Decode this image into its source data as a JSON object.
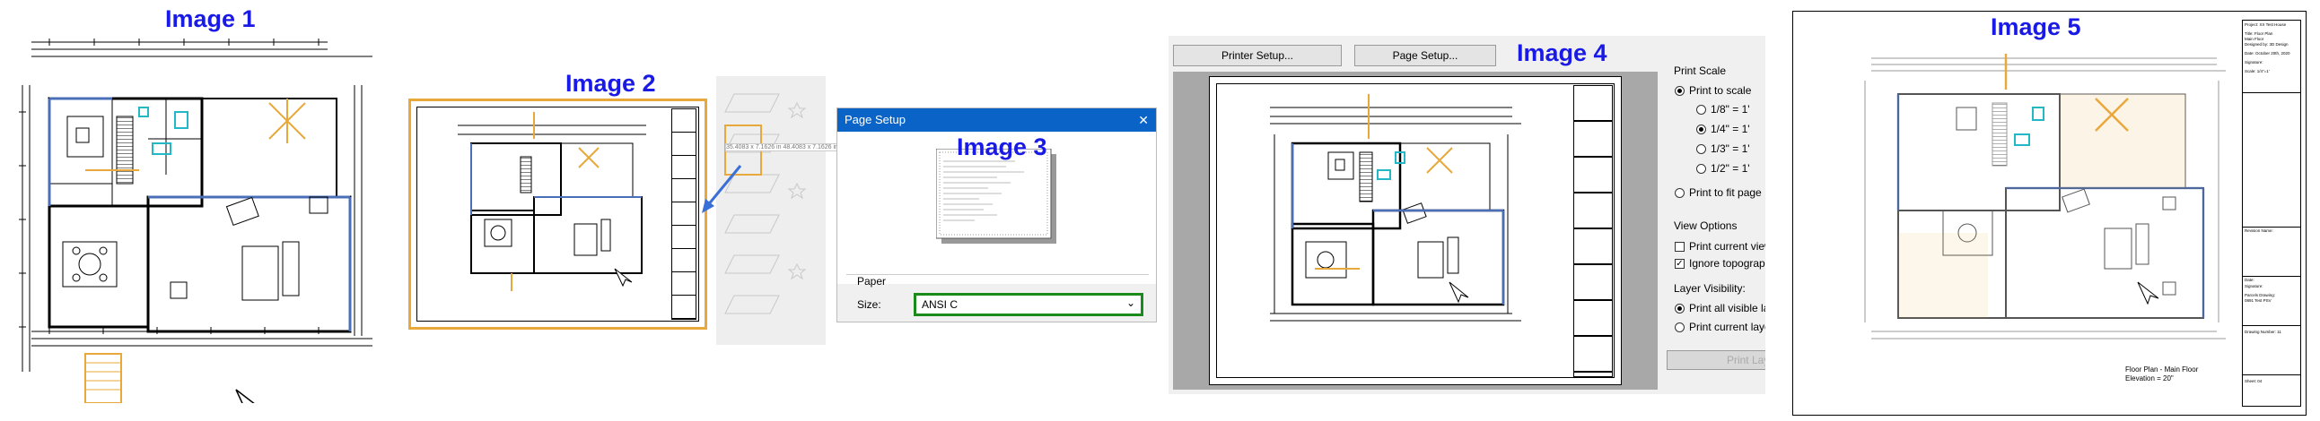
{
  "captions": {
    "image1": "Image 1",
    "image2": "Image 2",
    "image3": "Image 3",
    "image4": "Image 4",
    "image5": "Image 5"
  },
  "image2": {
    "coord_readout": "35.4083 x 7.1626 in 48.4083 x 7.1626 in"
  },
  "page_setup": {
    "title": "Page Setup",
    "close_glyph": "✕",
    "paper_group": "Paper",
    "size_label": "Size:",
    "size_value": "ANSI C"
  },
  "print_dialog": {
    "printer_setup_button": "Printer Setup...",
    "page_setup_button": "Page Setup...",
    "print_scale_label": "Print Scale",
    "print_to_scale": "Print to scale",
    "scales": [
      "1/8\" = 1'",
      "1/4\" = 1'",
      "1/3\" = 1'",
      "1/2\" = 1'"
    ],
    "selected_scale_index": 1,
    "print_to_fit": "Print to fit page",
    "view_options_label": "View Options",
    "print_current_view": "Print current view",
    "ignore_topography": "Ignore topography",
    "layer_visibility_label": "Layer Visibility:",
    "print_all_visible": "Print all visible layers",
    "print_current_layer": "Print current layer",
    "print_button": "Print Layout"
  },
  "sheet": {
    "project": "Project: XX Test House",
    "title_lines": [
      "Title: Floor Plan",
      "Main Floor",
      "Designed by: 3D Design"
    ],
    "date": "Date: October 20th, 2020",
    "signature": "Signature:",
    "scale": "Scale: 1/4\"=1'",
    "revision": "Revision Name:",
    "date2": "Date:",
    "signature2": "Signature:",
    "parcels": [
      "Parcels Drawing:",
      "0891 Test PSV"
    ],
    "drawing_number": "Drawing Number: 11",
    "sheet": "Sheet: 04",
    "caption_line1": "Floor Plan - Main Floor",
    "caption_line2": "Elevation = 20\""
  },
  "colors": {
    "caption_blue": "#1a1ae6",
    "dialog_title_bar": "#0a64c8",
    "selection_orange": "#e8a83a",
    "dropdown_border_green": "#1a8a1a",
    "wall_blue": "#4a6fb8",
    "fixture_cyan": "#22b8c8"
  }
}
